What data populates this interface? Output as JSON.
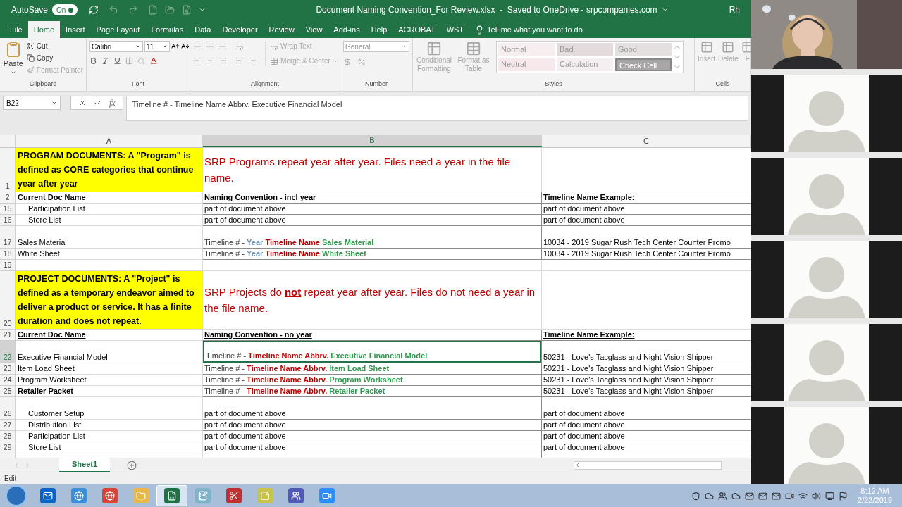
{
  "title_bar": {
    "autosave_label": "AutoSave",
    "autosave_state": "On",
    "autosave_on": true,
    "title": "Document Naming Convention_For Review.xlsx  -  Saved to OneDrive - srpcompanies.com",
    "user": "Rh"
  },
  "menu_tabs": [
    {
      "label": "File",
      "selected": false
    },
    {
      "label": "Home",
      "selected": true
    },
    {
      "label": "Insert",
      "selected": false
    },
    {
      "label": "Page Layout",
      "selected": false
    },
    {
      "label": "Formulas",
      "selected": false
    },
    {
      "label": "Data",
      "selected": false
    },
    {
      "label": "Developer",
      "selected": false
    },
    {
      "label": "Review",
      "selected": false
    },
    {
      "label": "View",
      "selected": false
    },
    {
      "label": "Add-ins",
      "selected": false
    },
    {
      "label": "Help",
      "selected": false
    },
    {
      "label": "ACROBAT",
      "selected": false
    },
    {
      "label": "WST",
      "selected": false
    }
  ],
  "tell_me": "Tell me what you want to do",
  "ribbon": [
    {
      "kind": "clipboard",
      "label": "Clipboard",
      "items": [
        {
          "label": "Paste",
          "disabled": false
        },
        {
          "label": "Cut",
          "disabled": false
        },
        {
          "label": "Copy",
          "disabled": false
        },
        {
          "label": "Format Painter",
          "disabled": true
        }
      ]
    },
    {
      "kind": "font",
      "label": "Font",
      "font": "Calibri",
      "size": "11"
    },
    {
      "kind": "alignment",
      "label": "Alignment",
      "items": [
        {
          "label": "Wrap Text",
          "disabled": true
        },
        {
          "label": "Merge & Center",
          "disabled": true
        }
      ]
    },
    {
      "kind": "number",
      "label": "Number",
      "format": "General"
    },
    {
      "kind": "styles",
      "label": "Styles",
      "items": [
        {
          "label": "Conditional Formatting",
          "disabled": true
        },
        {
          "label": "Format as Table",
          "disabled": true
        }
      ],
      "styles": [
        {
          "label": "Normal",
          "color": "#f7eef0",
          "kind": "light"
        },
        {
          "label": "Bad",
          "color": "#e4dcdc",
          "kind": "light"
        },
        {
          "label": "Good",
          "color": "#e4e0e0",
          "kind": "light"
        },
        {
          "label": "Neutral",
          "color": "#f6e8eb",
          "kind": "light"
        },
        {
          "label": "Calculation",
          "color": "#f6eff1",
          "kind": "light"
        },
        {
          "label": "Check Cell",
          "color": "#a8a6a6",
          "kind": "dark"
        }
      ]
    },
    {
      "kind": "cells",
      "label": "Cells",
      "items": [
        {
          "label": "Insert",
          "disabled": true
        },
        {
          "label": "Delete",
          "disabled": true
        },
        {
          "label": "F",
          "disabled": true
        }
      ]
    }
  ],
  "formula_bar": {
    "name_box": "B22",
    "function_button": "fx",
    "formula": "Timeline # - Timeline Name Abbrv. Executive Financial Model"
  },
  "columns": [
    {
      "label": "A",
      "selected": false
    },
    {
      "label": "B",
      "selected": true
    },
    {
      "label": "C",
      "selected": false
    }
  ],
  "rows": [
    {
      "number": "1",
      "kind": "banner",
      "a": "PROGRAM DOCUMENTS: A \"Program\" is defined as CORE categories that continue year after year",
      "b": "SRP Programs repeat year after year. Files need a year in the file name.",
      "selected": false
    },
    {
      "number": "2",
      "kind": "header",
      "a": "Current Doc Name",
      "b": "Naming Convention - incl year",
      "c": "Timeline Name Example:",
      "selected": false
    },
    {
      "number": "15",
      "kind": "item",
      "a": "Participation List",
      "a_bold": false,
      "a_indent": true,
      "b": "part of document above",
      "c": "part of document above",
      "selected": false
    },
    {
      "number": "16",
      "kind": "item",
      "a": "Store List",
      "a_bold": false,
      "a_indent": true,
      "b": "part of document above",
      "c": "part of document above",
      "selected": false
    },
    {
      "number": "17",
      "kind": "tall",
      "a": "Sales Material",
      "a_bold": false,
      "a_indent": false,
      "b": [
        {
          "text": "Timeline # - ",
          "kind": "plain"
        },
        {
          "text": "Year ",
          "kind": "year"
        },
        {
          "text": "Timeline Name ",
          "kind": "name"
        },
        {
          "text": "Sales Material",
          "kind": "doc"
        }
      ],
      "c": "10034 - 2019 Sugar Rush Tech Center Counter Promo",
      "selected": false
    },
    {
      "number": "18",
      "kind": "item",
      "a": "White Sheet",
      "a_bold": false,
      "a_indent": false,
      "b": [
        {
          "text": "Timeline # - ",
          "kind": "plain"
        },
        {
          "text": "Year ",
          "kind": "year"
        },
        {
          "text": "Timeline Name ",
          "kind": "name"
        },
        {
          "text": "White Sheet",
          "kind": "doc"
        }
      ],
      "c": "10034 - 2019 Sugar Rush Tech Center Counter Promo",
      "selected": false
    },
    {
      "number": "19",
      "kind": "gap",
      "selected": false
    },
    {
      "number": "20",
      "kind": "banner",
      "a": "PROJECT DOCUMENTS: A \"Project\" is defined as a temporary endeavor aimed to deliver a product or service. It has a finite duration and does not repeat.",
      "b": "SRP Projects do **not** repeat year after year. Files do not need a year in the file name.",
      "selected": false
    },
    {
      "number": "21",
      "kind": "header",
      "a": "Current Doc Name",
      "b": "Naming Convention - no year",
      "c": "Timeline Name Example:",
      "selected": false
    },
    {
      "number": "22",
      "kind": "tall",
      "a": "Executive Financial Model",
      "a_bold": false,
      "a_indent": false,
      "b": [
        {
          "text": "Timeline # - ",
          "kind": "plain"
        },
        {
          "text": "Timeline Name Abbrv. ",
          "kind": "name"
        },
        {
          "text": "Executive Financial Model",
          "kind": "doc"
        }
      ],
      "c": "50231 - Love's Tacglass and Night Vision Shipper",
      "selected": true
    },
    {
      "number": "23",
      "kind": "item",
      "a": "Item Load Sheet",
      "a_bold": false,
      "a_indent": false,
      "b": [
        {
          "text": "Timeline # - ",
          "kind": "plain"
        },
        {
          "text": "Timeline Name Abbrv. ",
          "kind": "name"
        },
        {
          "text": "Item Load Sheet",
          "kind": "doc"
        }
      ],
      "c": "50231 - Love's Tacglass and Night Vision Shipper",
      "selected": false
    },
    {
      "number": "24",
      "kind": "item",
      "a": "Program Worksheet",
      "a_bold": false,
      "a_indent": false,
      "b": [
        {
          "text": "Timeline # - ",
          "kind": "plain"
        },
        {
          "text": "Timeline Name Abbrv. ",
          "kind": "name"
        },
        {
          "text": "Program Worksheet",
          "kind": "doc"
        }
      ],
      "c": "50231 - Love's Tacglass and Night Vision Shipper",
      "selected": false
    },
    {
      "number": "25",
      "kind": "item",
      "a": "Retailer Packet",
      "a_bold": true,
      "a_indent": false,
      "b": [
        {
          "text": "Timeline # - ",
          "kind": "plain"
        },
        {
          "text": "Timeline Name Abbrv. ",
          "kind": "name"
        },
        {
          "text": "Retailer Packet",
          "kind": "doc"
        }
      ],
      "c": "50231 - Love's Tacglass and Night Vision Shipper",
      "selected": false
    },
    {
      "number": "26",
      "kind": "tall",
      "a": "Customer Setup",
      "a_bold": false,
      "a_indent": true,
      "b": "part of document above",
      "c": "part of document above",
      "selected": false
    },
    {
      "number": "27",
      "kind": "item",
      "a": "Distribution List",
      "a_bold": false,
      "a_indent": true,
      "b": "part of document above",
      "c": "part of document above",
      "selected": false
    },
    {
      "number": "28",
      "kind": "item",
      "a": "Participation List",
      "a_bold": false,
      "a_indent": true,
      "b": "part of document above",
      "c": "part of document above",
      "selected": false
    },
    {
      "number": "29",
      "kind": "item",
      "a": "Store List",
      "a_bold": false,
      "a_indent": true,
      "b": "part of document above",
      "c": "part of document above",
      "selected": false
    }
  ],
  "sheet_tabs": [
    {
      "label": "Sheet1",
      "selected": true
    }
  ],
  "status_bar": {
    "mode": "Edit"
  },
  "video_panel": {
    "tiles": [
      {
        "kind": "camera"
      },
      {
        "kind": "avatar"
      },
      {
        "kind": "avatar"
      },
      {
        "kind": "avatar"
      },
      {
        "kind": "avatar"
      },
      {
        "kind": "avatar"
      }
    ]
  },
  "taskbar": {
    "apps": [
      {
        "kind": "outlook",
        "selected": false
      },
      {
        "kind": "browser",
        "selected": false
      },
      {
        "kind": "chrome",
        "selected": false
      },
      {
        "kind": "folder",
        "selected": false
      },
      {
        "kind": "excel",
        "selected": true
      },
      {
        "kind": "notepad",
        "selected": false
      },
      {
        "kind": "scissors",
        "selected": false
      },
      {
        "kind": "notes",
        "selected": false
      },
      {
        "kind": "teams",
        "selected": false
      },
      {
        "kind": "video",
        "selected": false
      }
    ],
    "time": "8:12 AM",
    "date": "2/22/2019"
  }
}
